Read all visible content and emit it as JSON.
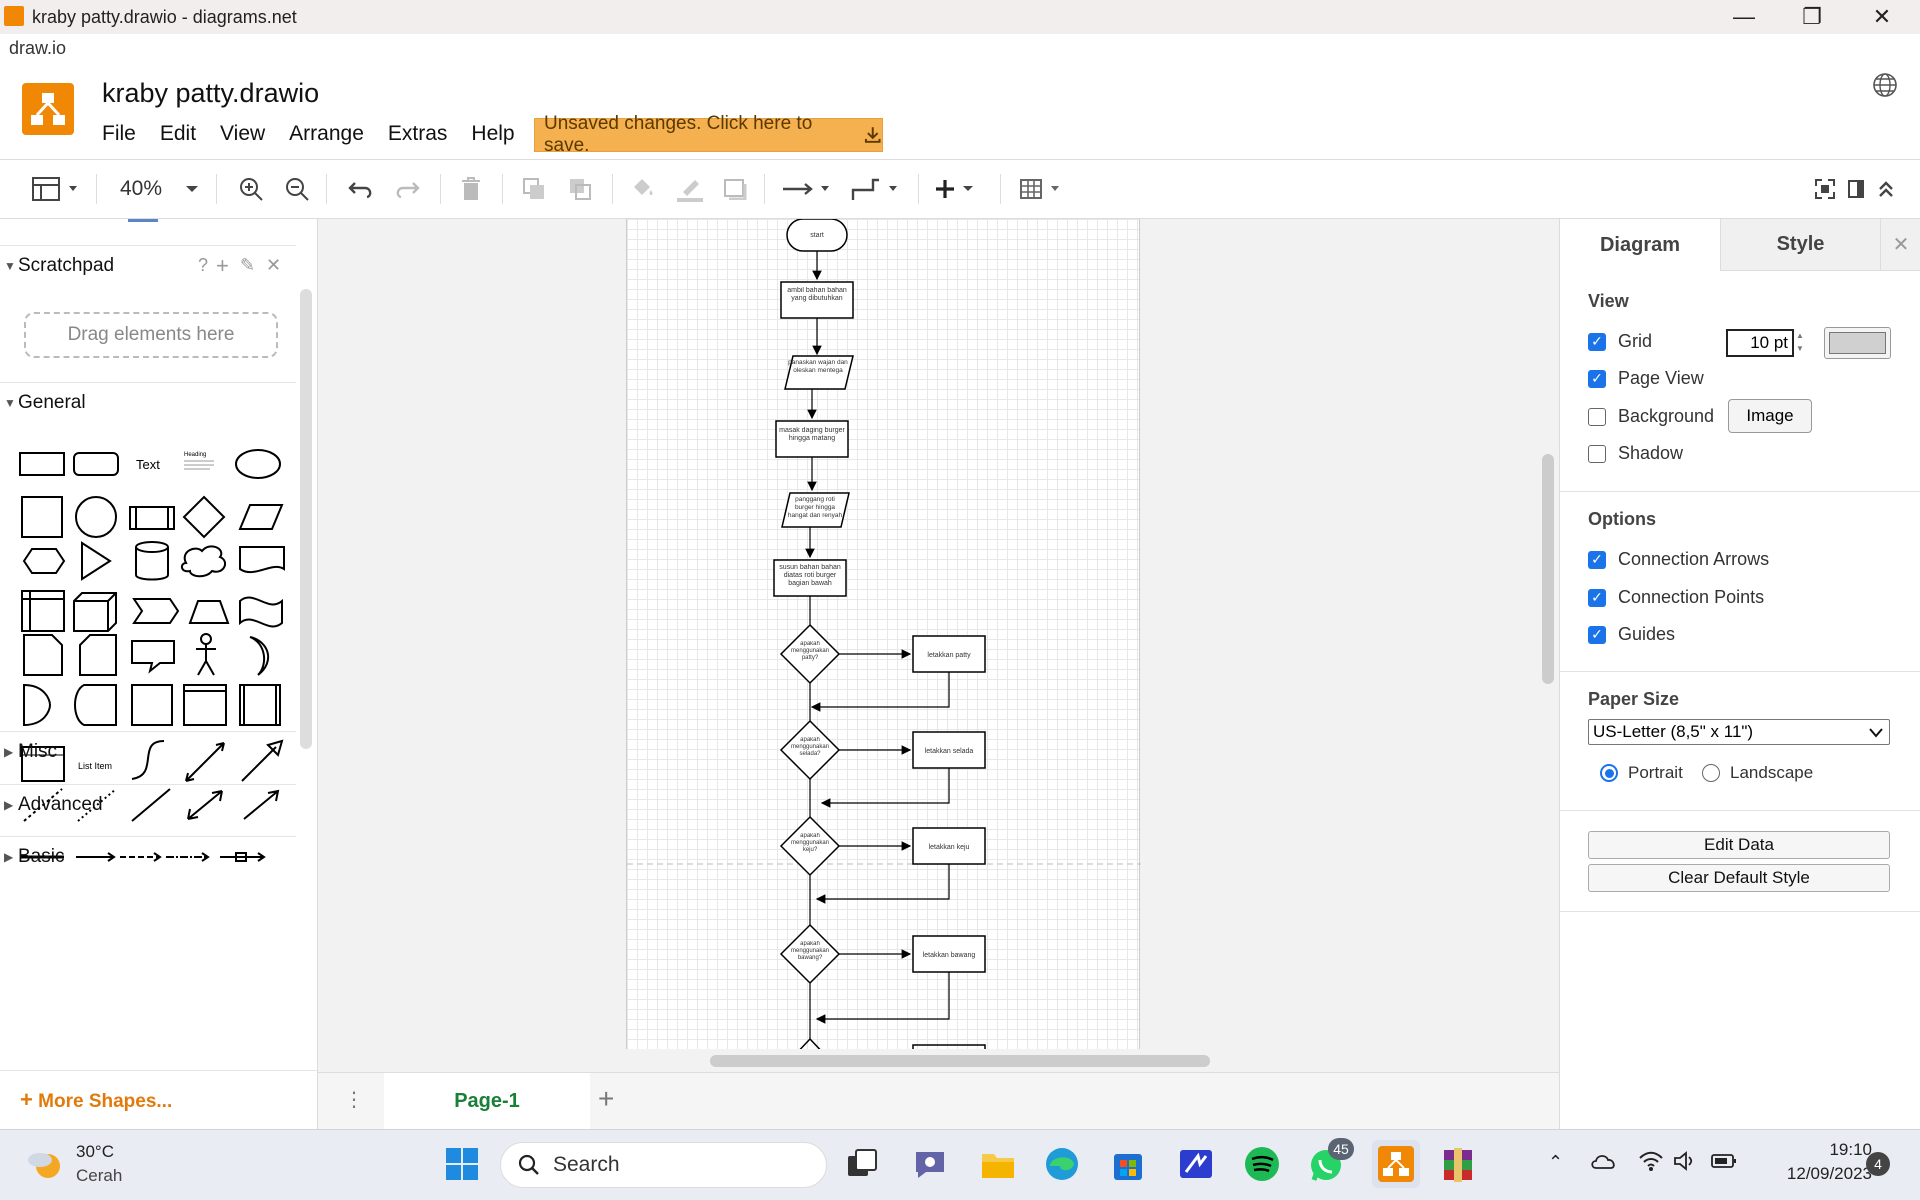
{
  "window": {
    "title": "kraby patty.drawio - diagrams.net",
    "address": "draw.io"
  },
  "header": {
    "doc_title": "kraby patty.drawio",
    "menus": [
      "File",
      "Edit",
      "View",
      "Arrange",
      "Extras",
      "Help"
    ],
    "save_banner": "Unsaved changes. Click here to save."
  },
  "toolbar": {
    "zoom": "40%"
  },
  "sidebar": {
    "scratchpad_label": "Scratchpad",
    "scratchpad_actions": [
      "?",
      "+",
      "✎",
      "✕"
    ],
    "drag_hint": "Drag elements here",
    "general_label": "General",
    "shape_text": "Text",
    "shape_heading": "Heading",
    "shape_list_item": "List Item",
    "collapsed_sections": [
      "Misc",
      "Advanced",
      "Basic"
    ],
    "more_shapes": "More Shapes..."
  },
  "diagram": {
    "nodes": [
      "start",
      "ambil bahan bahan yang dibutuhkan",
      "panaskan wajan dan oleskan mentega",
      "masak daging burger hingga matang",
      "panggang roti burger hingga hangat dan renyah",
      "susun bahan bahan diatas roti burger bagian bawah",
      "apakah menggunakan patty?",
      "letakkan patty",
      "apakah menggunakan selada?",
      "letakkan selada",
      "apakah menggunakan keju?",
      "letakkan keju",
      "apakah menggunakan bawang?",
      "letakkan bawang"
    ]
  },
  "pages": {
    "tabs": [
      "Page-1"
    ]
  },
  "format_panel": {
    "tabs": [
      "Diagram",
      "Style"
    ],
    "view_title": "View",
    "grid_label": "Grid",
    "grid_size": "10 pt",
    "page_view_label": "Page View",
    "background_label": "Background",
    "image_button": "Image",
    "shadow_label": "Shadow",
    "options_title": "Options",
    "connection_arrows": "Connection Arrows",
    "connection_points": "Connection Points",
    "guides": "Guides",
    "paper_size_title": "Paper Size",
    "paper_size_value": "US-Letter (8,5\" x 11\")",
    "portrait": "Portrait",
    "landscape": "Landscape",
    "edit_data": "Edit Data",
    "clear_default_style": "Clear Default Style",
    "checked": {
      "grid": true,
      "page_view": true,
      "background": false,
      "shadow": false,
      "connection_arrows": true,
      "connection_points": true,
      "guides": true
    },
    "orientation": "portrait"
  },
  "taskbar": {
    "weather_temp": "30°C",
    "weather_desc": "Cerah",
    "search_placeholder": "Search",
    "whatsapp_badge": "45",
    "time": "19:10",
    "date": "12/09/2023",
    "notification_count": "4"
  },
  "colors": {
    "accent": "#f08705",
    "checkbox": "#1a73e8",
    "page_tab": "#1a7f37",
    "save_banner": "#f5b04f"
  }
}
